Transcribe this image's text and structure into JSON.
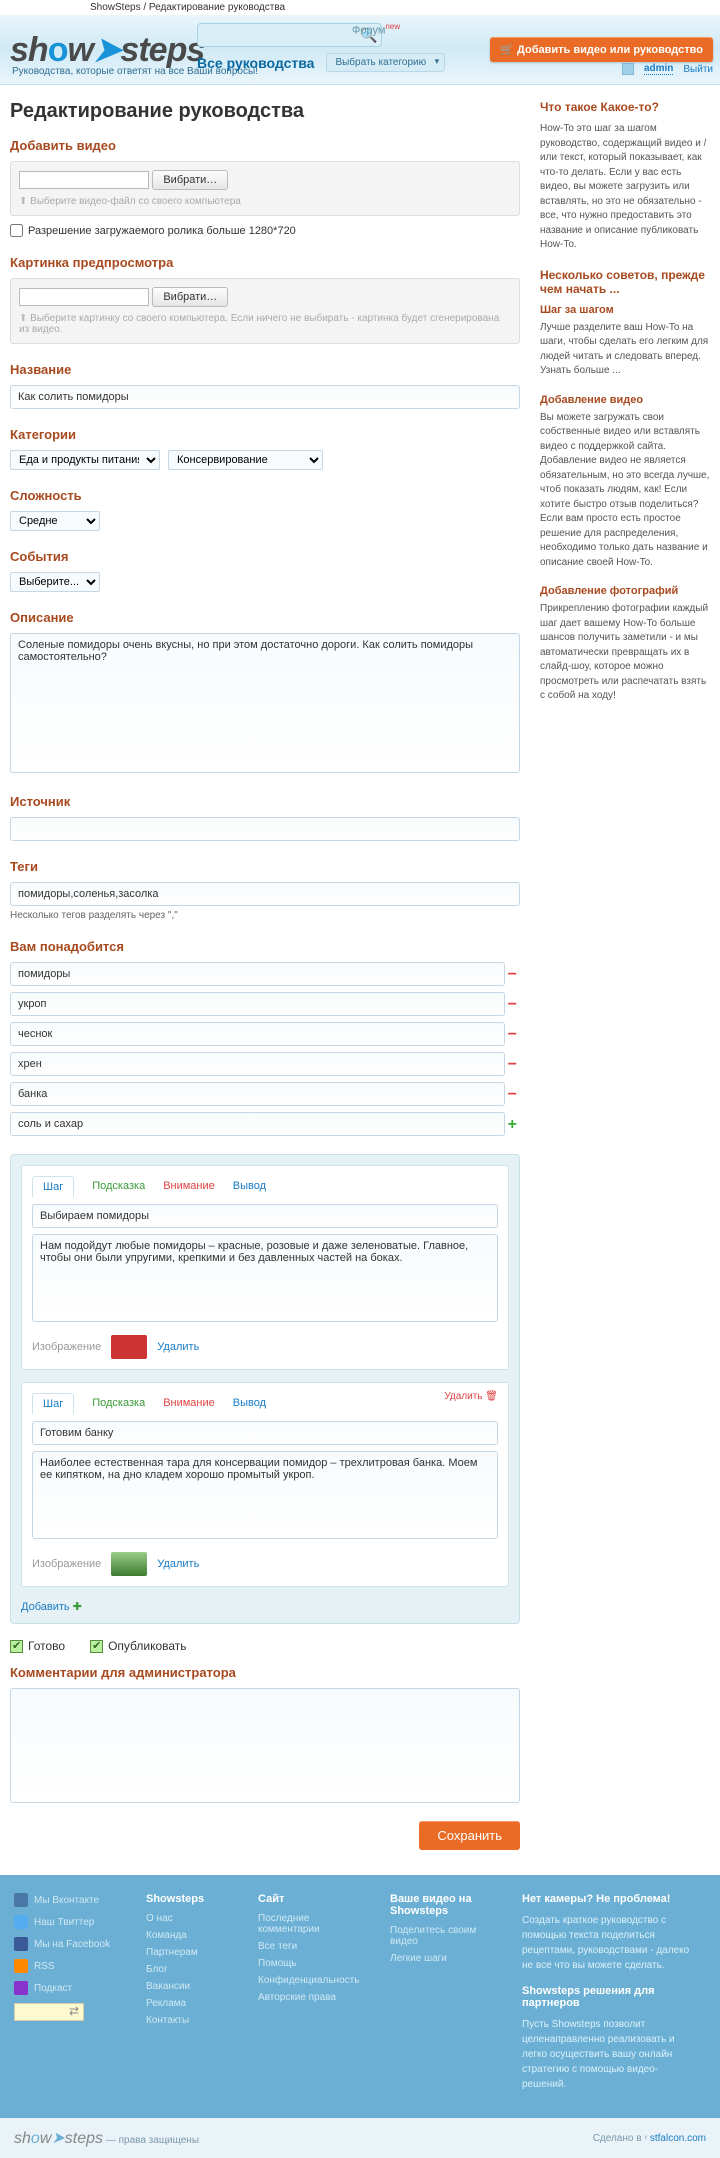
{
  "breadcrumb": "ShowSteps / Редактирование руководства",
  "logo": {
    "p1": "sh",
    "p2": "o",
    "p3": "w",
    "icon": "➤",
    "p4": "steps"
  },
  "tagline": "Руководства, которые ответят на все Ваши вопросы!",
  "forum": "Форум",
  "forum_new": "new",
  "nav_all": "Все руководства",
  "nav_cat": "Выбрать категорию",
  "add_btn": "Добавить видео или руководство",
  "admin": "admin",
  "logout": "Выйти",
  "h1": "Редактирование руководства",
  "f": {
    "video_h": "Добавить видео",
    "browse": "Вибрати…",
    "video_hint": "Выберите видео-файл со своего компьютера",
    "res_label": "Разрешение загружаемого ролика больше 1280*720",
    "preview_h": "Картинка предпросмотра",
    "preview_hint": "Выберите картинку со своего компьютера. Если ничего не выбирать - картинка будет сгенерирована из видео.",
    "name_h": "Название",
    "name_v": "Как солить помидоры",
    "cat_h": "Категории",
    "cat1": "Еда и продукты питания",
    "cat2": "Консервирование",
    "diff_h": "Сложность",
    "diff_v": "Средне",
    "event_h": "События",
    "event_v": "Выберите...",
    "desc_h": "Описание",
    "desc_v": "Соленые помидоры очень вкусны, но при этом достаточно дороги. Как солить помидоры самостоятельно?",
    "src_h": "Источник",
    "tags_h": "Теги",
    "tags_v": "помидоры,соленья,засолка",
    "tags_note": "Несколько тегов разделять через \",\"",
    "need_h": "Вам понадобится",
    "needs": [
      "помидоры",
      "укроп",
      "чеснок",
      "хрен",
      "банка",
      "соль и сахар"
    ],
    "tab_step": "Шаг",
    "tab_hint": "Подсказка",
    "tab_warn": "Внимание",
    "tab_out": "Вывод",
    "step_del": "Удалить",
    "step1_t": "Выбираем помидоры",
    "step1_b": "Нам подойдут любые помидоры – красные, розовые и даже зеленоватые. Главное, чтобы они были упругими, крепкими и без давленных частей на боках.",
    "step2_t": "Готовим банку",
    "step2_b": "Наиболее естественная тара для консервации помидор – трехлитровая банка. Моем ее кипятком, на дно кладем хорошо промытый укроп.",
    "img_label": "Изображение",
    "img_del": "Удалить",
    "add_step": "Добавить",
    "ready": "Готово",
    "publish": "Опубликовать",
    "admin_com_h": "Комментарии для администратора",
    "save": "Сохранить"
  },
  "side": {
    "h1": "Что такое Какое-то?",
    "p1": "How-To это шаг за шагом руководство, содержащий видео и / или текст, который показывает, как что-то делать. Если у вас есть видео, вы можете загрузить или вставлять, но это не обязательно - все, что нужно предоставить это название и описание публиковать How-To.",
    "h2": "Несколько советов, прежде чем начать ...",
    "h3": "Шаг за шагом",
    "p2": "Лучше разделите ваш How-To на шаги, чтобы сделать его легким для людей читать и следовать вперед. Узнать больше ...",
    "h4": "Добавление видео",
    "p3": "Вы можете загружать свои собственные видео или вставлять видео с поддержкой сайта. Добавление видео не является обязательным, но это всегда лучше, чтоб показать людям, как! Если хотите быстро отзыв поделиться? Если вам просто есть простое решение для распределения, необходимо только дать название и описание своей How-To.",
    "h5": "Добавление фотографий",
    "p4": "Прикреплению фотографии каждый шаг дает вашему How-To больше шансов получить заметили - и мы автоматически превращать их в слайд-шоу, которое можно просмотреть или распечатать взять с собой на ходу!"
  },
  "foot": {
    "soc": [
      "Мы Вконтакте",
      "Наш Твиттер",
      "Мы на Facebook",
      "RSS",
      "Подкаст"
    ],
    "c1_h": "Showsteps",
    "c1": [
      "О нас",
      "Команда",
      "Партнерам",
      "Блог",
      "Вакансии",
      "Реклама",
      "Контакты"
    ],
    "c2_h": "Сайт",
    "c2": [
      "Последние комментарии",
      "Все теги",
      "Помощь",
      "Конфиденциальность",
      "Авторские права"
    ],
    "c3_h": "Ваше видео на Showsteps",
    "c3": [
      "Поделитесь своим видео",
      "Легкие шаги"
    ],
    "c4_h1": "Нет камеры? Не проблема!",
    "c4_p1": "Создать краткое руководство с помощью текста поделиться рецептами, руководствами - далеко не все что вы можете сделать.",
    "c4_h2": "Showsteps решения для партнеров",
    "c4_p2": "Пусть Showsteps позволит целенаправленно реализовать и легко осуществить вашу онлайн стратегию с помощью видео-решений.",
    "rights": "— права защищены",
    "made": "Сделано в",
    "by": "stfalcon.com"
  }
}
